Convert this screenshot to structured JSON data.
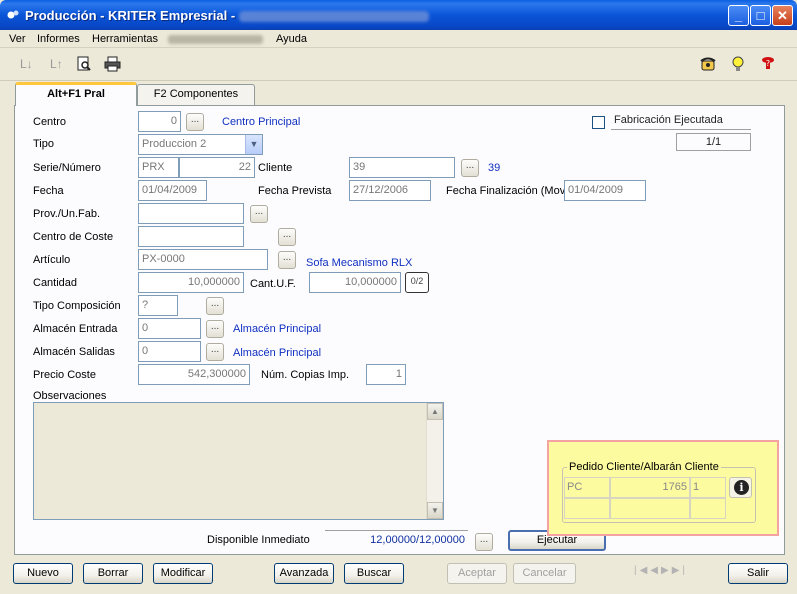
{
  "window": {
    "title": "Producción - KRITER Empresrial  -",
    "minimize": "_",
    "maximize": "□",
    "close": "✕"
  },
  "menu": [
    "Ver",
    "Informes",
    "Herramientas",
    "Ayuda"
  ],
  "tabs": [
    "Alt+F1 Pral",
    "F2 Componentes"
  ],
  "form": {
    "centro_label": "Centro",
    "centro_value": "0",
    "centro_name": "Centro Principal",
    "fabricacion_label": "Fabricación Ejecutada",
    "page_counter": "1/1",
    "tipo_label": "Tipo",
    "tipo_value": "Produccion 2",
    "serie_label": "Serie/Número",
    "serie_value": "PRX",
    "numero_value": "22",
    "cliente_label": "Cliente",
    "cliente_value": "39",
    "cliente_link": "39",
    "fecha_label": "Fecha",
    "fecha_value": "01/04/2009",
    "fecha_prevista_label": "Fecha Prevista",
    "fecha_prevista_value": "27/12/2006",
    "fecha_fin_label": "Fecha Finalización (Mov.",
    "fecha_fin_value": "01/04/2009",
    "prov_label": "Prov./Un.Fab.",
    "prov_value": "",
    "centro_coste_label": "Centro de Coste",
    "centro_coste_value": "",
    "articulo_label": "Artículo",
    "articulo_value": "PX-0000",
    "articulo_name": "Sofa Mecanismo RLX",
    "cantidad_label": "Cantidad",
    "cantidad_value": "10,000000",
    "cant_uf_label": "Cant.U.F.",
    "cant_uf_value": "10,000000",
    "tipo_comp_label": "Tipo Composición",
    "tipo_comp_value": "?",
    "alm_entrada_label": "Almacén Entrada",
    "alm_entrada_value": "0",
    "alm_entrada_name": "Almacén Principal",
    "alm_salidas_label": "Almacén Salidas",
    "alm_salidas_value": "0",
    "alm_salidas_name": "Almacén Principal",
    "precio_label": "Precio Coste",
    "precio_value": "542,300000",
    "copias_label": "Núm. Copias Imp.",
    "copias_value": "1",
    "observaciones_label": "Observaciones",
    "observaciones_value": "",
    "disponible_label": "Disponible Inmediato",
    "disponible_value": "12,00000/12,00000",
    "ejecutar_label": "Ejecutar",
    "dots": "...",
    "conv_icon_text": "0/2"
  },
  "pedido": {
    "title": "Pedido Cliente/Albarán Cliente",
    "serie": "PC",
    "numero": "1765",
    "linea": "1"
  },
  "buttons": {
    "nuevo": "Nuevo",
    "borrar": "Borrar",
    "modificar": "Modificar",
    "avanzada": "Avanzada",
    "buscar": "Buscar",
    "aceptar": "Aceptar",
    "cancelar": "Cancelar",
    "salir": "Salir"
  },
  "icons": {
    "sort_desc": "sort-desc-icon",
    "sort_asc": "sort-asc-icon",
    "preview": "print-preview-icon",
    "print": "printer-icon",
    "phone": "phone-icon",
    "bulb": "lightbulb-icon",
    "help": "help-icon",
    "info": "info-icon"
  }
}
